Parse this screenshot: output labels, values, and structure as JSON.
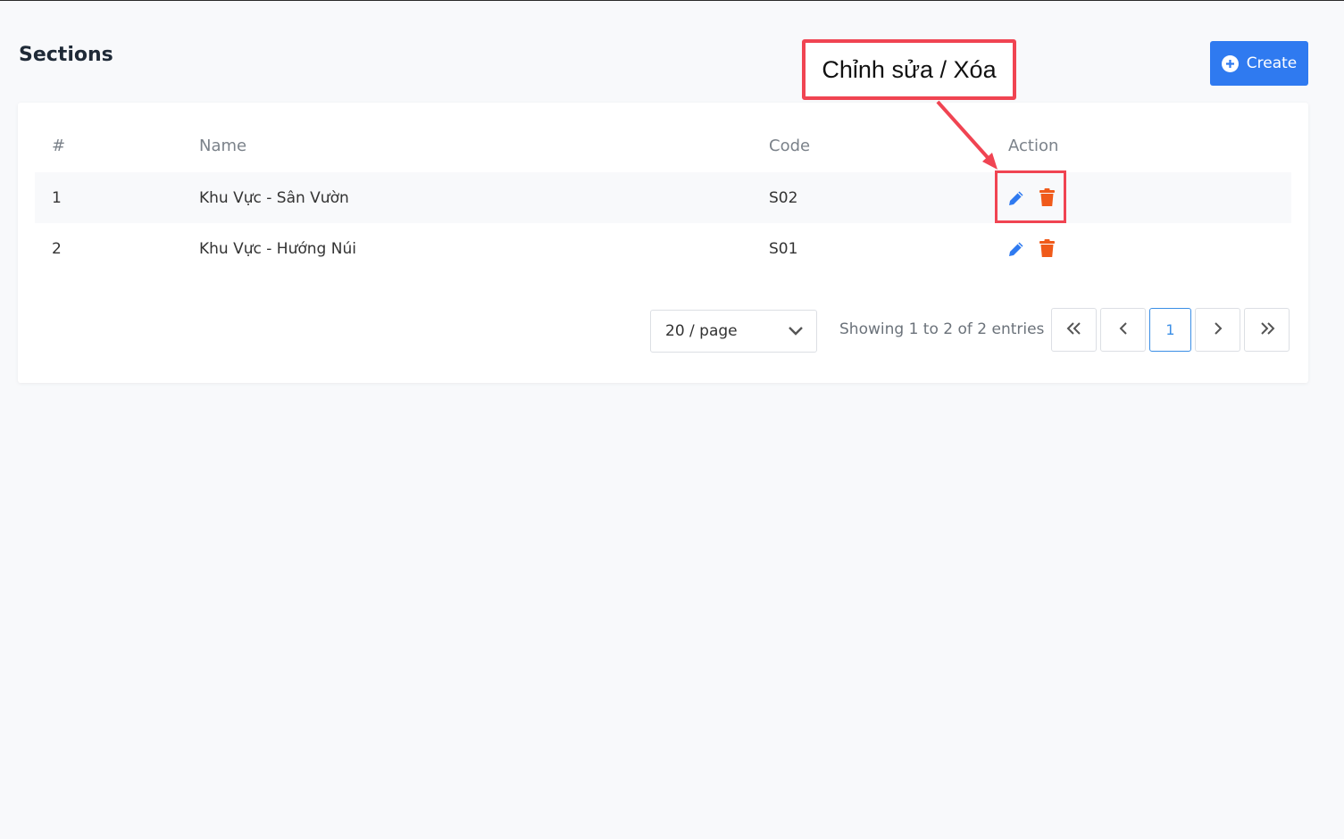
{
  "page": {
    "title": "Sections"
  },
  "toolbar": {
    "create_label": "Create"
  },
  "table": {
    "columns": [
      "#",
      "Name",
      "Code",
      "Action"
    ],
    "rows": [
      {
        "index": "1",
        "name": "Khu Vực - Sân Vườn",
        "code": "S02"
      },
      {
        "index": "2",
        "name": "Khu Vực - Hướng Núi",
        "code": "S01"
      }
    ]
  },
  "pagination": {
    "page_size": "20 / page",
    "summary": "Showing 1 to 2 of 2 entries",
    "current_page": "1"
  },
  "annotation": {
    "label": "Chỉnh sửa / Xóa",
    "color": "#f04452"
  },
  "colors": {
    "primary": "#2f7af0",
    "edit": "#2f7af0",
    "delete": "#f05a1a"
  }
}
